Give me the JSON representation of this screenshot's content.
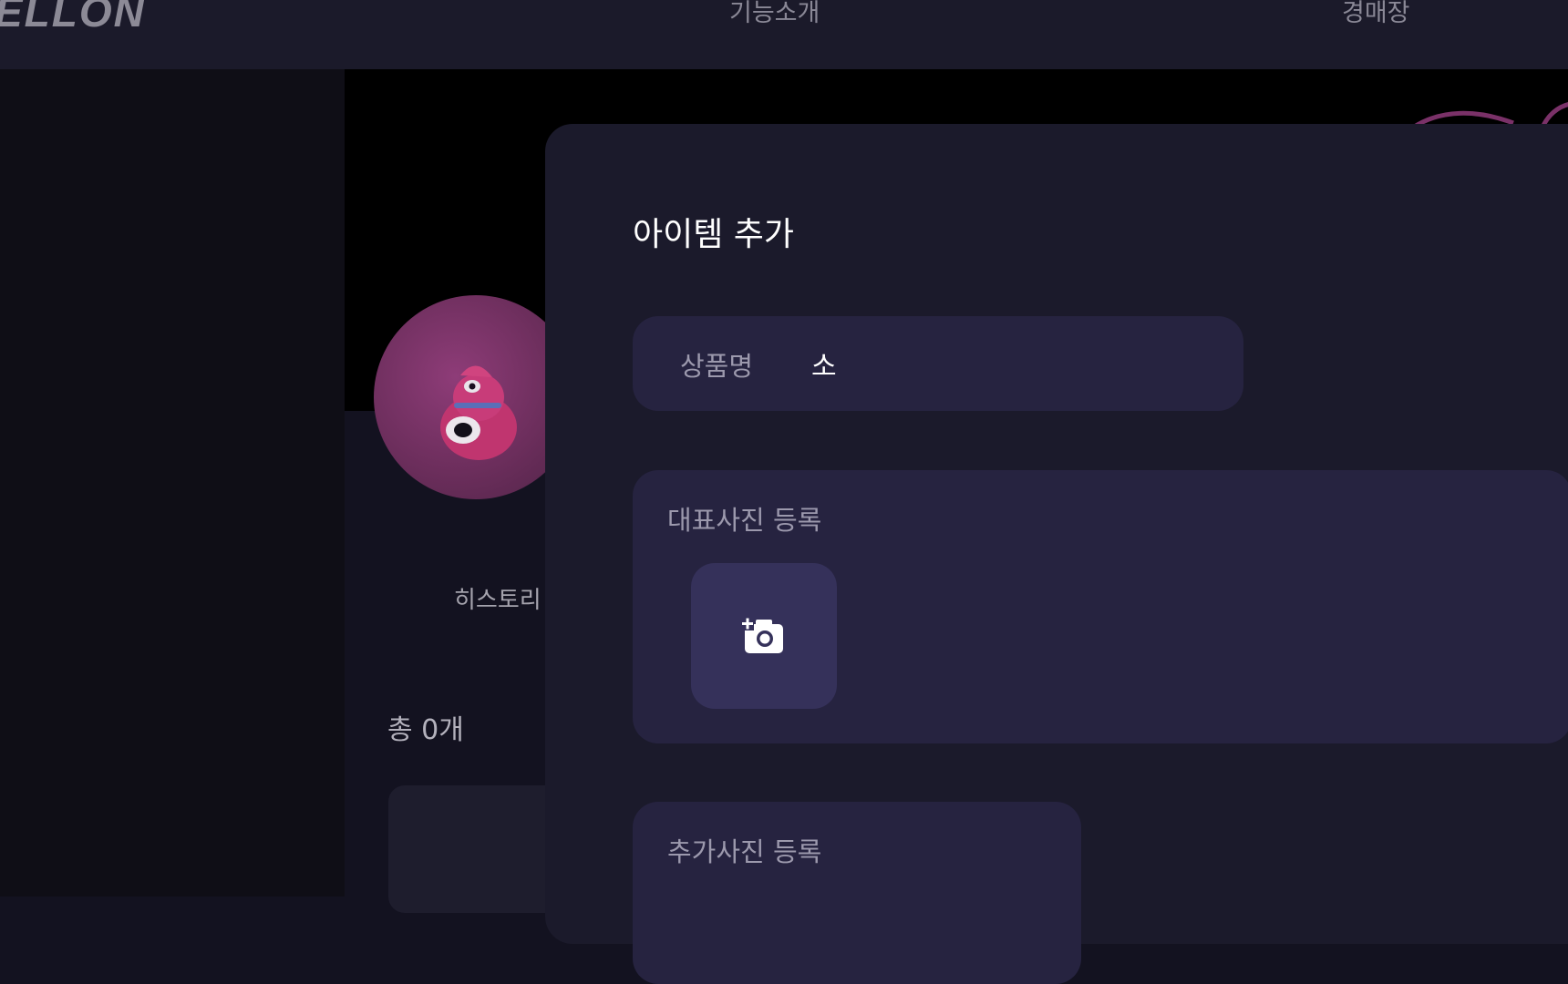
{
  "header": {
    "logo_text": "ELLON",
    "nav": [
      "기능소개",
      "경매장"
    ]
  },
  "profile": {
    "history_label": "히스토리",
    "total_label": "총 0개"
  },
  "modal": {
    "title": "아이템 추가",
    "name_field": {
      "label": "상품명",
      "value": "소"
    },
    "main_photo": {
      "label": "대표사진 등록",
      "icon": "add-photo-icon"
    },
    "extra_photo": {
      "label": "추가사진 등록"
    }
  },
  "colors": {
    "background": "#131220",
    "modal": "#1b1a2b",
    "field": "#262340",
    "upload_button": "#35315a",
    "avatar": "#7a3168"
  }
}
